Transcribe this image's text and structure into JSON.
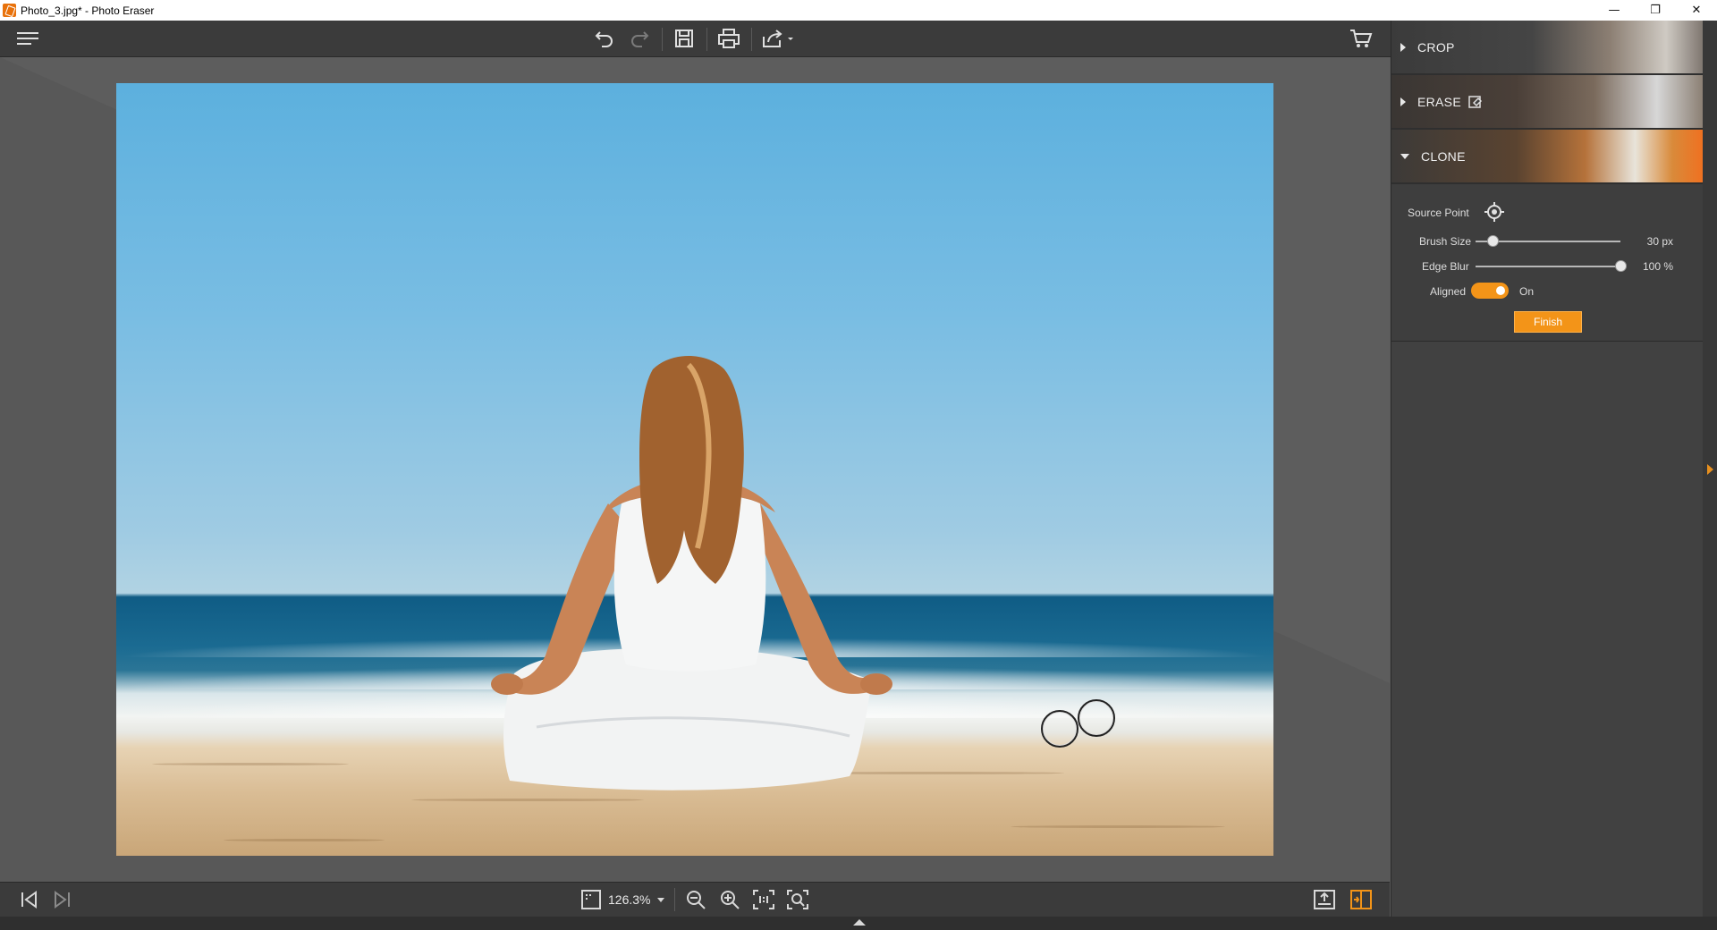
{
  "window": {
    "title": "Photo_3.jpg* - Photo Eraser",
    "minimize_glyph": "—",
    "restore_glyph": "❐",
    "close_glyph": "✕"
  },
  "toolbar": {
    "icons": [
      "menu-icon",
      "undo-icon",
      "redo-icon",
      "save-icon",
      "print-icon",
      "share-icon",
      "cart-icon"
    ]
  },
  "panel": {
    "sections": [
      {
        "label": "CROP",
        "expanded": false
      },
      {
        "label": "ERASE",
        "expanded": false
      },
      {
        "label": "CLONE",
        "expanded": true
      }
    ],
    "clone": {
      "source_point_label": "Source Point",
      "brush_size_label": "Brush Size",
      "brush_size_value": "30 px",
      "brush_size_fraction": 0.12,
      "edge_blur_label": "Edge Blur",
      "edge_blur_value": "100 %",
      "edge_blur_fraction": 1.0,
      "aligned_label": "Aligned",
      "aligned_state": "On",
      "finish_label": "Finish"
    },
    "accent_color": "#f39418"
  },
  "bottombar": {
    "zoom": "126.3%",
    "icons": [
      "first-image-icon",
      "next-image-icon",
      "fit-icon",
      "zoom-out-icon",
      "zoom-in-icon",
      "actual-size-icon",
      "zoom-fit-icon",
      "export-icon",
      "compare-icon"
    ]
  }
}
